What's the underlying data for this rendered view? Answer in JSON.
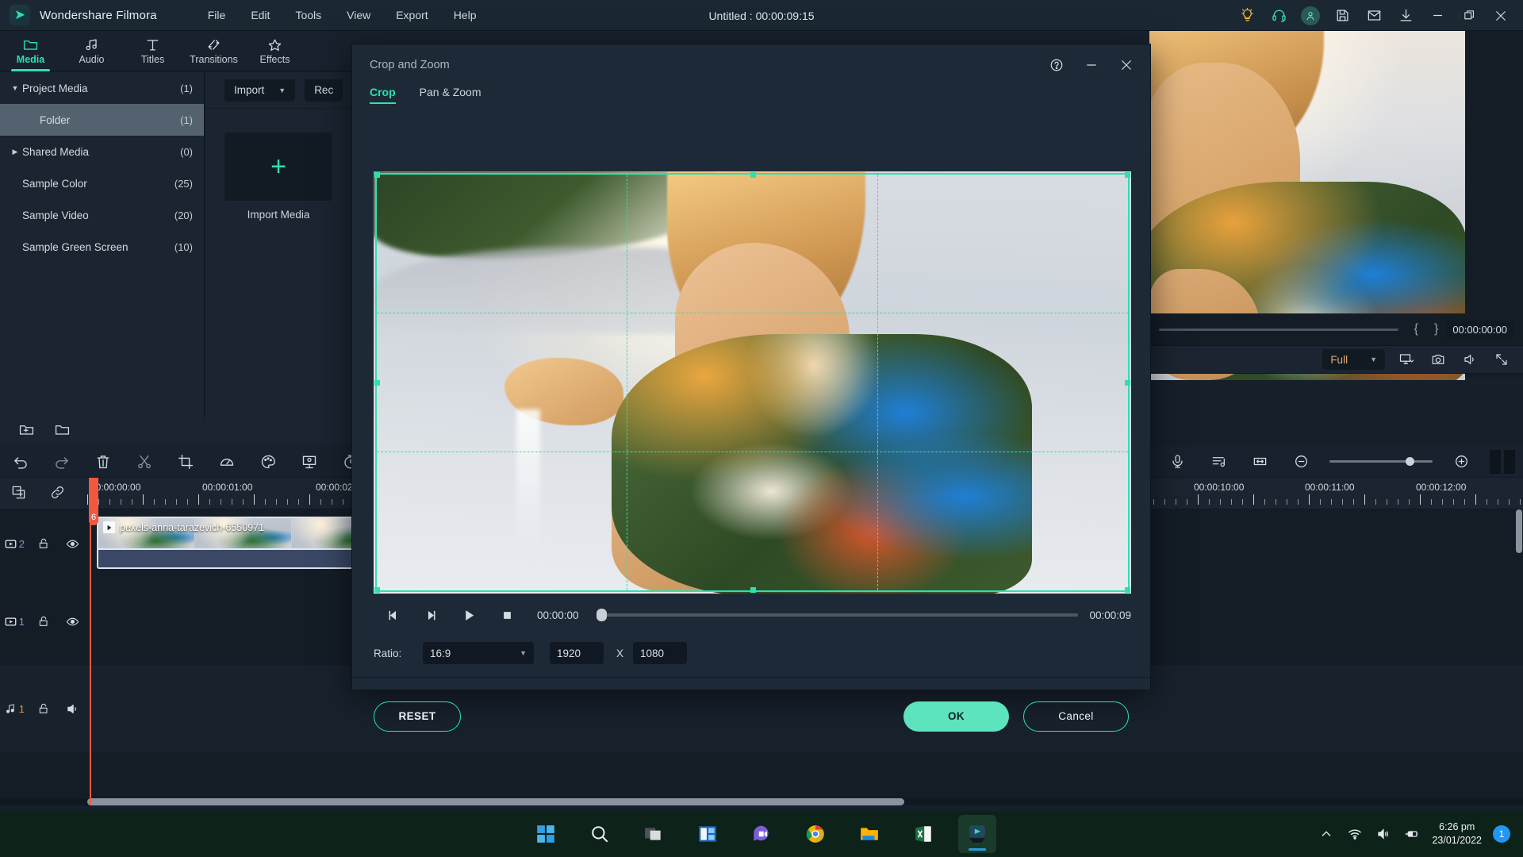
{
  "app": {
    "name": "Wondershare Filmora",
    "project_title": "Untitled : 00:00:09:15",
    "logo_glyph": "➤"
  },
  "menubar": [
    {
      "label": "File"
    },
    {
      "label": "Edit"
    },
    {
      "label": "Tools"
    },
    {
      "label": "View"
    },
    {
      "label": "Export"
    },
    {
      "label": "Help"
    }
  ],
  "titlebar_icons": [
    {
      "name": "tips-bulb-icon"
    },
    {
      "name": "support-headset-icon"
    },
    {
      "name": "account-avatar-icon"
    },
    {
      "name": "save-icon"
    },
    {
      "name": "mail-icon"
    },
    {
      "name": "download-icon"
    },
    {
      "name": "minimize-icon"
    },
    {
      "name": "restore-icon"
    },
    {
      "name": "close-icon"
    }
  ],
  "topnav": [
    {
      "label": "Media",
      "icon": "folder-icon",
      "active": true
    },
    {
      "label": "Audio",
      "icon": "music-note-icon",
      "active": false
    },
    {
      "label": "Titles",
      "icon": "text-t-icon",
      "active": false
    },
    {
      "label": "Transitions",
      "icon": "transitions-icon",
      "active": false
    },
    {
      "label": "Effects",
      "icon": "effects-star-icon",
      "active": false
    }
  ],
  "media_tree": [
    {
      "label": "Project Media",
      "count": "(1)",
      "twisty": "▼",
      "selected": false,
      "indent": false
    },
    {
      "label": "Folder",
      "count": "(1)",
      "twisty": "",
      "selected": true,
      "indent": true
    },
    {
      "label": "Shared Media",
      "count": "(0)",
      "twisty": "▶",
      "selected": false,
      "indent": false
    },
    {
      "label": "Sample Color",
      "count": "(25)",
      "twisty": "",
      "selected": false,
      "indent": false
    },
    {
      "label": "Sample Video",
      "count": "(20)",
      "twisty": "",
      "selected": false,
      "indent": false
    },
    {
      "label": "Sample Green Screen",
      "count": "(10)",
      "twisty": "",
      "selected": false,
      "indent": false
    }
  ],
  "media_panel": {
    "import_button": "Import",
    "record_button": "Rec",
    "import_tile_label": "Import Media",
    "plus": "+"
  },
  "preview": {
    "timecode": "00:00:00:00",
    "left_brace": "{",
    "right_brace": "}",
    "quality": "Full"
  },
  "timeline": {
    "ruler_left": [
      "00:00:00:00",
      "00:00:01:00",
      "00:00:02"
    ],
    "ruler_right": [
      "00:00:10:00",
      "00:00:11:00",
      "00:00:12:00"
    ],
    "playhead_label": "6",
    "clip_name": "pexels-anna-tarazevich-6550971",
    "tracks": [
      {
        "type": "video",
        "number": "2"
      },
      {
        "type": "video",
        "number": "1"
      },
      {
        "type": "audio",
        "number": "1"
      }
    ]
  },
  "dialog": {
    "title": "Crop and Zoom",
    "tabs": [
      {
        "label": "Crop",
        "active": true
      },
      {
        "label": "Pan & Zoom",
        "active": false
      }
    ],
    "playback": {
      "current_time": "00:00:00",
      "total_time": "00:00:09"
    },
    "ratio": {
      "label": "Ratio:",
      "value": "16:9",
      "width": "1920",
      "separator": "X",
      "height": "1080"
    },
    "buttons": {
      "reset": "RESET",
      "ok": "OK",
      "cancel": "Cancel"
    },
    "icons": {
      "help": "help-icon",
      "minimize": "minimize-icon",
      "close": "close-icon"
    }
  },
  "taskbar": {
    "items": [
      {
        "name": "windows-start-icon",
        "running": false
      },
      {
        "name": "search-icon",
        "running": false
      },
      {
        "name": "task-view-icon",
        "running": false
      },
      {
        "name": "widgets-icon",
        "running": false
      },
      {
        "name": "teams-chat-icon",
        "running": false
      },
      {
        "name": "google-chrome-icon",
        "running": true
      },
      {
        "name": "file-explorer-icon",
        "running": true
      },
      {
        "name": "excel-icon",
        "running": true
      },
      {
        "name": "filmora-icon",
        "running": true,
        "active": true
      }
    ],
    "tray": {
      "chevron": "show-hidden-icons",
      "wifi": "wifi-icon",
      "volume": "volume-icon",
      "battery": "battery-charging-icon",
      "time": "6:26 pm",
      "date": "23/01/2022",
      "notification_count": "1"
    }
  },
  "colors": {
    "accent": "#2ee0b0",
    "accent_button": "#5de3bd",
    "playhead": "#f4573f",
    "panel_bg": "#1a2531",
    "dialog_bg": "#1d2936",
    "titlebar_bg": "#1b2733"
  }
}
